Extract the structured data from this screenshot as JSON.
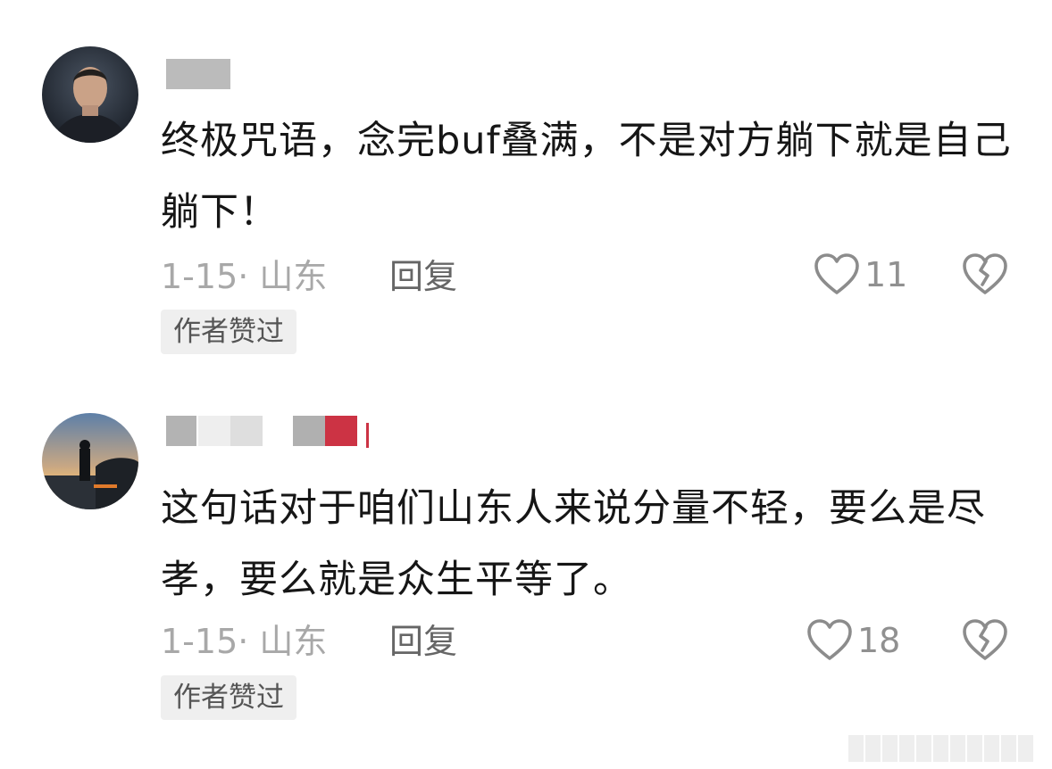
{
  "comments": [
    {
      "text": "终极咒语，念完buf叠满，不是对方躺下就是自己躺下！",
      "date_location": "1-15· 山东",
      "reply_label": "回复",
      "like_count": "11",
      "badge": "作者赞过"
    },
    {
      "text": "这句话对于咱们山东人来说分量不轻，要么是尽孝，要么就是众生平等了。",
      "date_location": "1-15· 山东",
      "reply_label": "回复",
      "like_count": "18",
      "badge": "作者赞过"
    }
  ],
  "colors": {
    "text": "#161616",
    "meta": "#a8a8a8",
    "reply": "#666666",
    "icon": "#8c8c8c",
    "badge_bg": "#efefef",
    "username_blur": "#b5b5b5",
    "username_accent": "#cc3344"
  },
  "icons": [
    "heart-outline-icon",
    "broken-heart-icon"
  ]
}
